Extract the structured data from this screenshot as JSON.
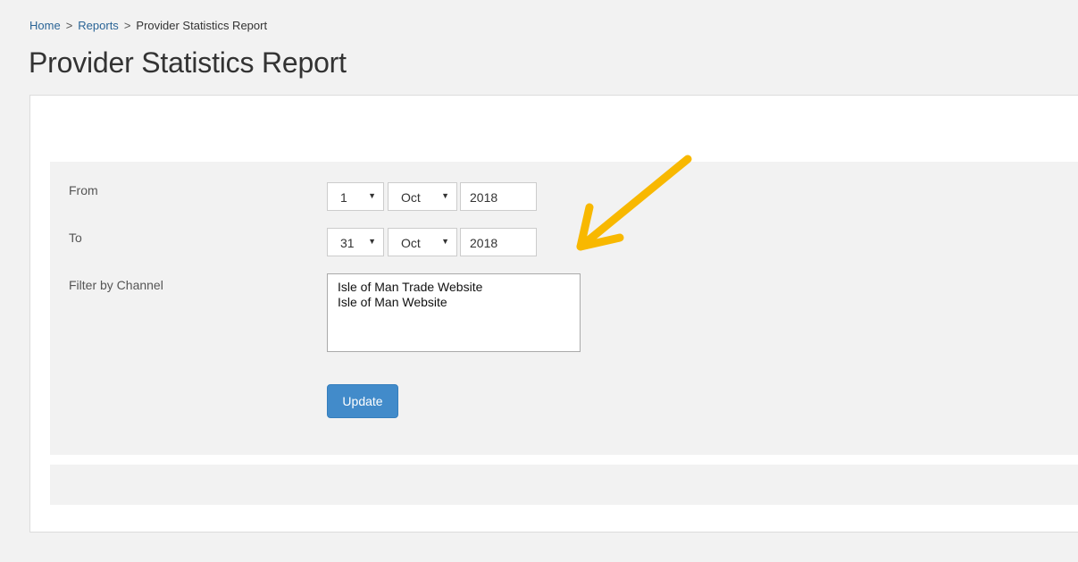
{
  "breadcrumb": {
    "home": "Home",
    "separator": ">",
    "reports": "Reports",
    "current": "Provider Statistics Report"
  },
  "page": {
    "title": "Provider Statistics Report"
  },
  "form": {
    "from": {
      "label": "From",
      "day": "1",
      "month": "Oct",
      "year": "2018"
    },
    "to": {
      "label": "To",
      "day": "31",
      "month": "Oct",
      "year": "2018"
    },
    "channel": {
      "label": "Filter by Channel",
      "options": [
        "Isle of Man Trade Website",
        "Isle of Man Website"
      ]
    },
    "update_label": "Update"
  },
  "colors": {
    "link": "#2a6496",
    "button": "#428bca",
    "annotation_arrow": "#f8b800"
  },
  "icons": {
    "dropdown": "caret-down-icon",
    "annotation": "arrow-annotation"
  }
}
